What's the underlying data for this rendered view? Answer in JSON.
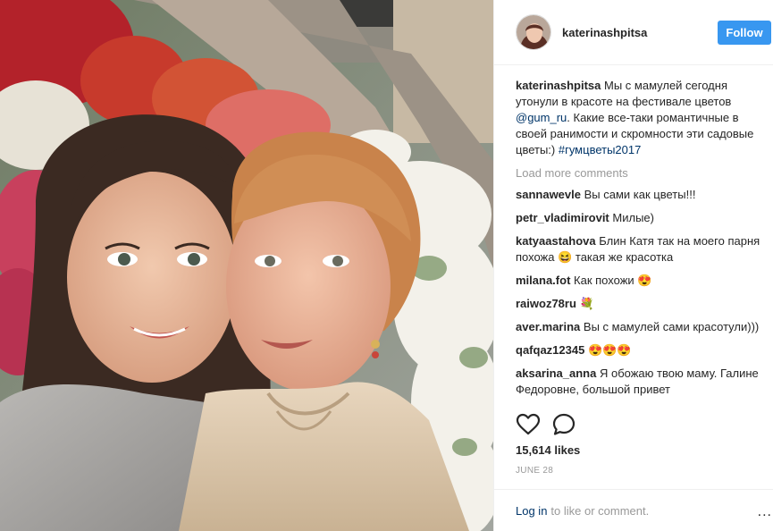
{
  "post": {
    "author": "katerinashpitsa",
    "follow_label": "Follow",
    "caption": {
      "user": "katerinashpitsa",
      "text_1": "Мы с мамулей сегодня утонули в красоте на фестивале цветов ",
      "mention": "@gum_ru",
      "text_2": ". Какие все-таки романтичные в своей ранимости и скромности эти садовые цветы:) ",
      "hashtag": "#гумцветы2017"
    },
    "load_more": "Load more comments",
    "comments": [
      {
        "user": "sannawevle",
        "text": "Вы сами как цветы!!!"
      },
      {
        "user": "petr_vladimirovit",
        "text": "Милые)"
      },
      {
        "user": "katyaastahova",
        "text": "Блин Катя так на моего парня похожа 😆 такая же красотка"
      },
      {
        "user": "milana.fot",
        "text": "Как похожи 😍"
      },
      {
        "user": "raiwoz78ru",
        "text": "💐"
      },
      {
        "user": "aver.marina",
        "text": "Вы с мамулей сами красотули)))"
      },
      {
        "user": "qafqaz12345",
        "text": "😍😍😍"
      },
      {
        "user": "aksarina_anna",
        "text": "Я обожаю твою маму. Галине Федоровне, большой привет"
      }
    ],
    "likes": "15,614 likes",
    "date": "JUNE 28",
    "login_label": "Log in",
    "login_rest": "to like or comment.",
    "more_dots": "..."
  },
  "icons": {
    "like": "heart-outline-icon",
    "comment": "speech-bubble-icon"
  },
  "colors": {
    "follow_button": "#3897f0",
    "link": "#003569",
    "muted": "#999999"
  }
}
